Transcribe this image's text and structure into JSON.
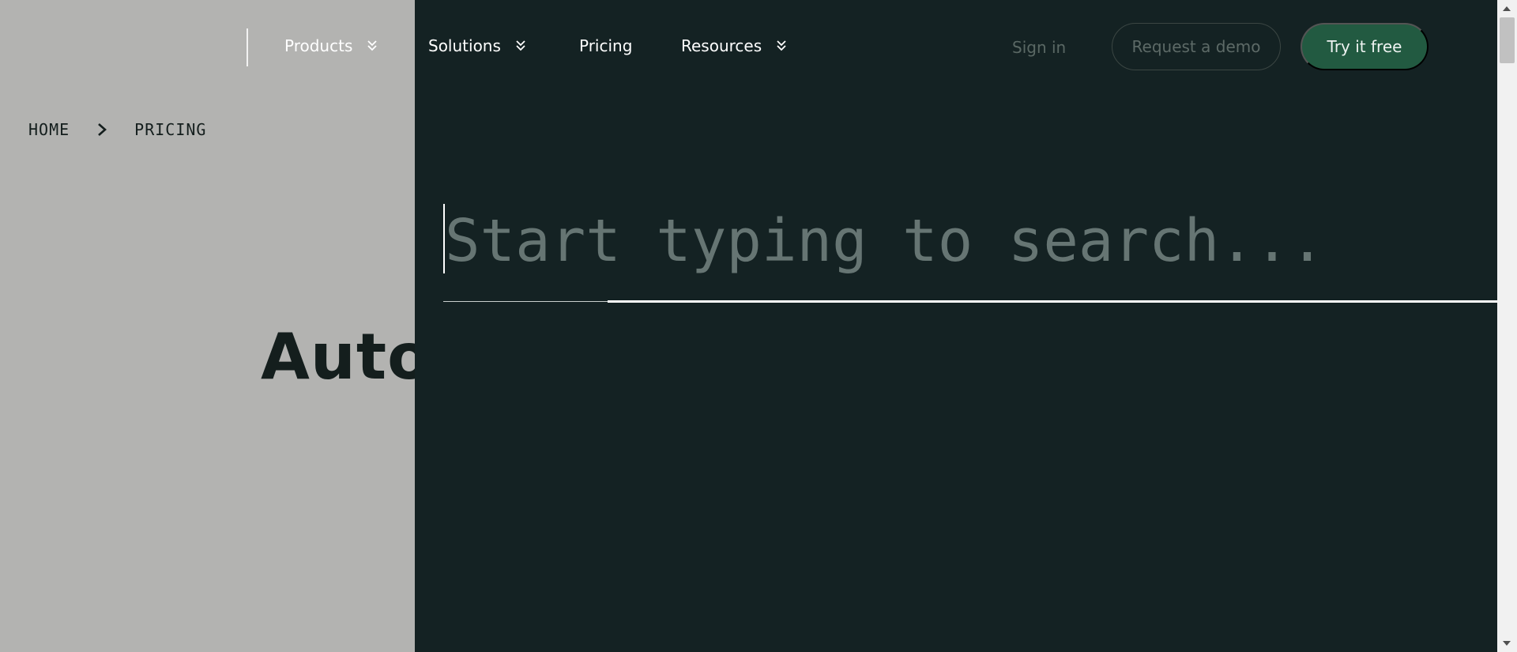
{
  "nav": {
    "items": [
      {
        "label": "Products",
        "has_dropdown": true
      },
      {
        "label": "Solutions",
        "has_dropdown": true
      },
      {
        "label": "Pricing",
        "has_dropdown": false
      },
      {
        "label": "Resources",
        "has_dropdown": true
      }
    ],
    "sign_in": "Sign in",
    "request_demo": "Request a demo",
    "try_free": "Try it free"
  },
  "breadcrumb": {
    "home": "HOME",
    "current": "PRICING"
  },
  "hero": {
    "title_partial": "Autor"
  },
  "search": {
    "placeholder": "Start typing to search...",
    "value": ""
  },
  "colors": {
    "overlay_bg": "#142223",
    "dim_bg": "#b3b3b1",
    "accent": "#225a41"
  }
}
